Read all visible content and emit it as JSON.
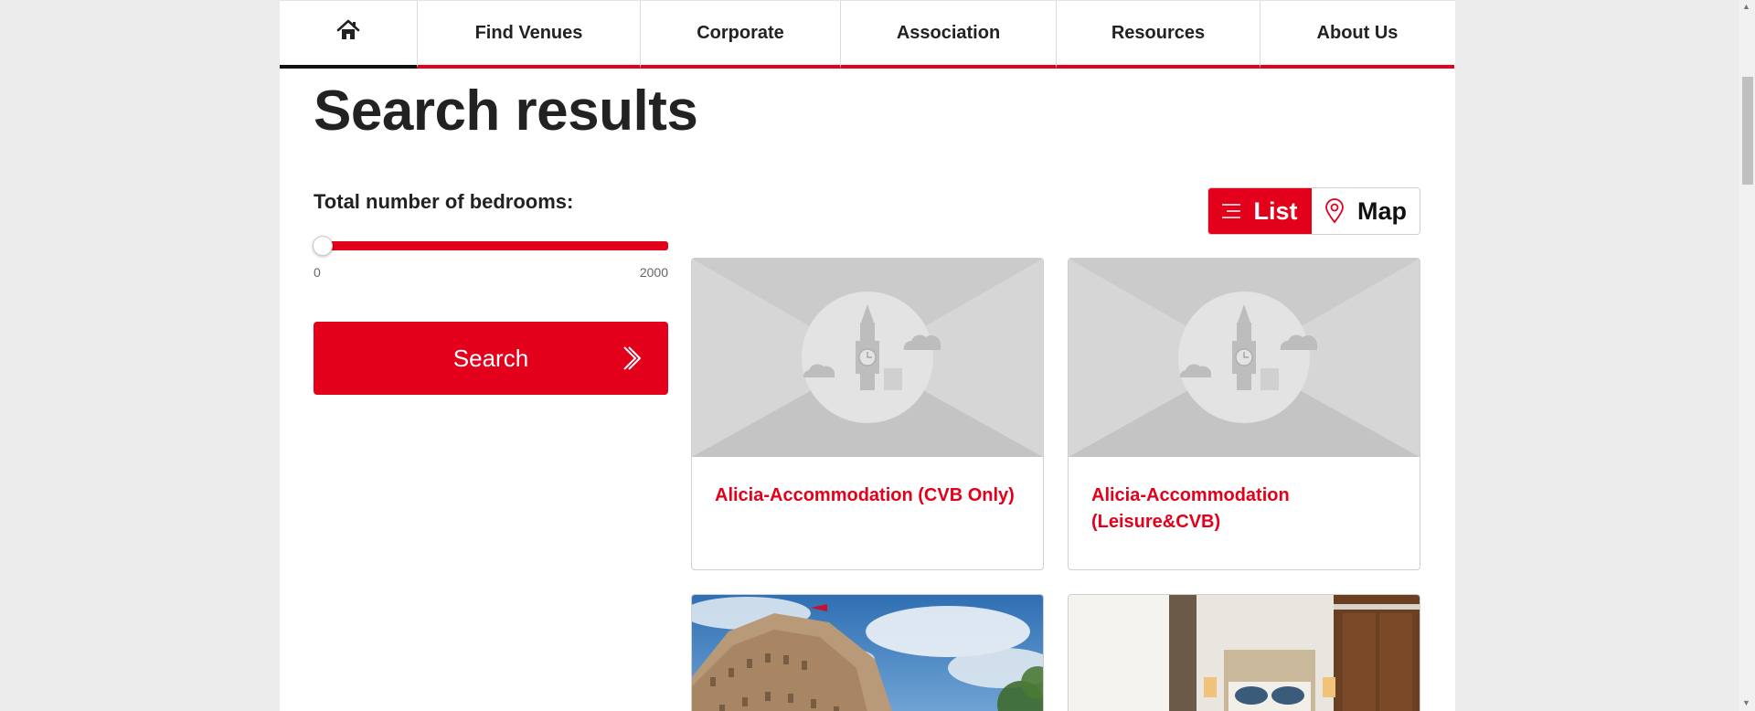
{
  "nav": {
    "home_icon": "home-icon",
    "items": [
      {
        "label": "Find Venues"
      },
      {
        "label": "Corporate"
      },
      {
        "label": "Association"
      },
      {
        "label": "Resources"
      },
      {
        "label": "About Us"
      }
    ]
  },
  "page": {
    "title": "Search results"
  },
  "filters": {
    "bedrooms_label": "Total number of bedrooms:",
    "bedrooms_min": "0",
    "bedrooms_max": "2000",
    "bedrooms_value": 0,
    "search_button": "Search"
  },
  "view_toggle": {
    "list_label": "List",
    "map_label": "Map",
    "active": "list"
  },
  "results": [
    {
      "name": "Alicia-Accommodation (CVB Only)",
      "image": "placeholder-big-ben"
    },
    {
      "name": "Alicia-Accommodation (Leisure&CVB)",
      "image": "placeholder-big-ben"
    },
    {
      "name": "",
      "image": "photo-building-sky"
    },
    {
      "name": "",
      "image": "photo-hotel-room"
    }
  ],
  "colors": {
    "accent": "#e2001a",
    "placeholder_bg": "#d6d6d6"
  }
}
